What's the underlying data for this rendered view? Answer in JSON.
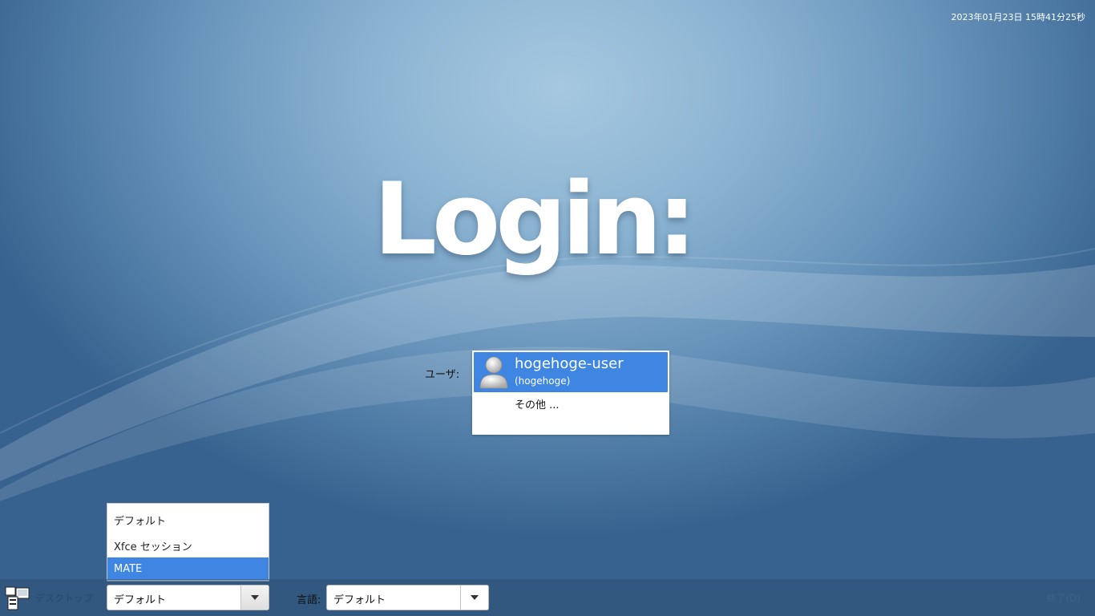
{
  "datetime": "2023年01月23日 15時41分25秒",
  "title": "Login:",
  "user_label": "ユーザ:",
  "users": [
    {
      "name": "hogehoge-user",
      "login": "(hogehoge)",
      "selected": true
    },
    {
      "name": "その他 ...",
      "selected": false
    }
  ],
  "session": {
    "label": "デスクトップ",
    "value": "デフォルト",
    "options": [
      "デフォルト",
      "Xfce セッション",
      "MATE"
    ],
    "highlighted": "MATE"
  },
  "language": {
    "label": "言語:",
    "value": "デフォルト"
  },
  "shutdown_label": "終了(D)",
  "colors": {
    "selection": "#3f86e3",
    "background": "#6d98be"
  }
}
